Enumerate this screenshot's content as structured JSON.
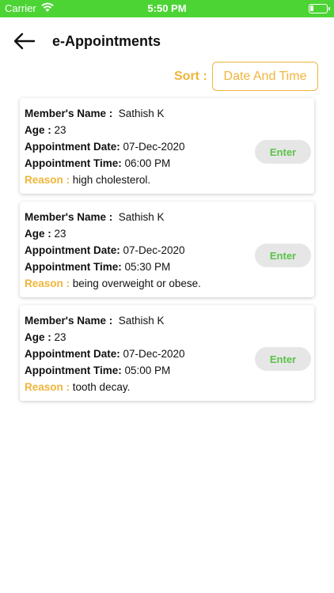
{
  "status_bar": {
    "carrier": "Carrier",
    "time": "5:50 PM"
  },
  "header": {
    "title": "e-Appointments"
  },
  "sort": {
    "label": "Sort :",
    "value": "Date And Time"
  },
  "labels": {
    "member_name": "Member's Name :",
    "age": "Age :",
    "appointment_date": "Appointment  Date:",
    "appointment_time": "Appointment Time:",
    "reason": "Reason :",
    "enter": "Enter"
  },
  "appointments": [
    {
      "member_name": "Sathish K",
      "age": "23",
      "date": "07-Dec-2020",
      "time": "06:00 PM",
      "reason": "high cholesterol."
    },
    {
      "member_name": "Sathish K",
      "age": "23",
      "date": "07-Dec-2020",
      "time": "05:30 PM",
      "reason": "being overweight or obese."
    },
    {
      "member_name": "Sathish K",
      "age": "23",
      "date": "07-Dec-2020",
      "time": "05:00 PM",
      "reason": "tooth decay."
    }
  ],
  "colors": {
    "status_bar": "#4cd435",
    "accent": "#f0b53a",
    "enter_text": "#5cc24a",
    "enter_bg": "#e6e6e6"
  }
}
